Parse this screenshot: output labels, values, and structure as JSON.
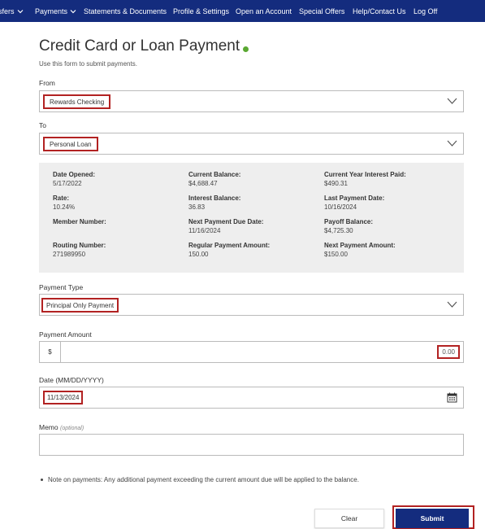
{
  "topnav": {
    "items": [
      {
        "label": "sfers",
        "has_dropdown": true
      },
      {
        "label": "Payments",
        "has_dropdown": true
      },
      {
        "label": "Statements & Documents",
        "has_dropdown": false
      },
      {
        "label": "Profile & Settings",
        "has_dropdown": false
      },
      {
        "label": "Open an Account",
        "has_dropdown": false
      },
      {
        "label": "Special Offers",
        "has_dropdown": false
      },
      {
        "label": "Help/Contact Us",
        "has_dropdown": false
      },
      {
        "label": "Log Off",
        "has_dropdown": false
      }
    ]
  },
  "page": {
    "title": "Credit Card or Loan Payment",
    "subtitle": "Use this form to submit payments."
  },
  "form": {
    "from": {
      "label": "From",
      "value": "Rewards Checking"
    },
    "to": {
      "label": "To",
      "value": "Personal Loan"
    },
    "payment_type": {
      "label": "Payment Type",
      "value": "Principal Only Payment"
    },
    "payment_amount": {
      "label": "Payment Amount",
      "prefix": "$",
      "value": "0.00"
    },
    "date": {
      "label": "Date (MM/DD/YYYY)",
      "value": "11/13/2024"
    },
    "memo": {
      "label": "Memo",
      "optional_tag": "(optional)",
      "value": ""
    }
  },
  "loan_details": {
    "date_opened": {
      "label": "Date Opened:",
      "value": "5/17/2022"
    },
    "current_balance": {
      "label": "Current Balance:",
      "value": "$4,688.47"
    },
    "current_year_interest_paid": {
      "label": "Current Year Interest Paid:",
      "value": "$490.31"
    },
    "rate": {
      "label": "Rate:",
      "value": "10.24%"
    },
    "interest_balance": {
      "label": "Interest Balance:",
      "value": "36.83"
    },
    "last_payment_date": {
      "label": "Last Payment Date:",
      "value": "10/16/2024"
    },
    "member_number": {
      "label": "Member Number:",
      "value": ""
    },
    "next_payment_due_date": {
      "label": "Next Payment Due Date:",
      "value": "11/16/2024"
    },
    "payoff_balance": {
      "label": "Payoff Balance:",
      "value": "$4,725.30"
    },
    "routing_number": {
      "label": "Routing Number:",
      "value": "271989950"
    },
    "regular_payment_amount": {
      "label": "Regular Payment Amount:",
      "value": "150.00"
    },
    "next_payment_amount": {
      "label": "Next Payment Amount:",
      "value": "$150.00"
    }
  },
  "note": "Note on payments: Any additional payment exceeding the current amount due will be applied to the balance.",
  "buttons": {
    "clear": "Clear",
    "submit": "Submit"
  },
  "colors": {
    "nav_bg": "#142c7e",
    "submit_bg": "#142c7e",
    "highlight_border": "#b22222",
    "status_dot": "#5aa832",
    "panel_bg": "#eeeeee"
  },
  "icons": {
    "dropdown": "chevron-down-icon",
    "calendar": "calendar-icon",
    "info": "status-dot-icon"
  }
}
